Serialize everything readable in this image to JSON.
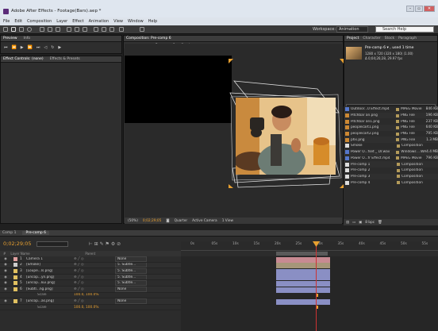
{
  "window": {
    "title": "Adobe After Effects - Footage(Bars).aep *",
    "buttons": [
      "–",
      "▫",
      "✕"
    ]
  },
  "menu": [
    "File",
    "Edit",
    "Composition",
    "Layer",
    "Effect",
    "Animation",
    "View",
    "Window",
    "Help"
  ],
  "toolbar": {
    "workspace_label": "Workspace:",
    "workspace_value": "Animation",
    "search_placeholder": "Search Help"
  },
  "left_panel": {
    "tabs": [
      "Preview",
      "Info"
    ],
    "effect_tabs": [
      "Effect Controls: (none)",
      "Effects & Presets"
    ]
  },
  "composition": {
    "tab": "Composition: Pre-comp 6",
    "sub_tabs": [
      "Pre-comp 6",
      "Smoke"
    ],
    "footer": {
      "zoom": "(50%)",
      "timecode": "0;02;29;05",
      "quality": "Quarter",
      "camera": "Active Camera",
      "views": "1 View"
    }
  },
  "project": {
    "tabs": [
      "Project",
      "Character",
      "Stock",
      "Paragraph"
    ],
    "selected_name": "Pre-comp 6 ▾ , used 1 time",
    "selected_info": [
      "1280 x 720 (320 x 180) (1.00)",
      "Δ 0;04;26;28, 29.97 fps"
    ],
    "columns": [
      "Name",
      "Type",
      "Size"
    ],
    "items": [
      {
        "name": "Outdoor...0 Effect.mp4",
        "type": "MPEG Movie",
        "size": "846 KB",
        "color": "#5577cc"
      },
      {
        "name": "Pitchbar an.png",
        "type": "PNG File",
        "size": "196 KB",
        "color": "#cc8833"
      },
      {
        "name": "Pitchbar an1.png",
        "type": "PNG File",
        "size": "237 KB",
        "color": "#cc8833"
      },
      {
        "name": "peoplecart1.png",
        "type": "PNG File",
        "size": "640 KB",
        "color": "#cc8833"
      },
      {
        "name": "peoplecart2.png",
        "type": "PNG File",
        "size": "795 KB",
        "color": "#cc8833"
      },
      {
        "name": "phx.png",
        "type": "PNG File",
        "size": "1.3 MB",
        "color": "#cc8833"
      },
      {
        "name": "Smoke",
        "type": "Composition",
        "size": "",
        "color": "#dddddd"
      },
      {
        "name": "Power O...fset _ Dr.wav",
        "type": "Windows ...WAV",
        "size": "4.4 MB",
        "color": "#5577cc"
      },
      {
        "name": "Power O...fr Effect.mp4",
        "type": "MPEG Movie",
        "size": "796 KB",
        "color": "#5577cc"
      },
      {
        "name": "Pre-comp 1",
        "type": "Composition",
        "size": "",
        "color": "#dddddd"
      },
      {
        "name": "Pre-comp 2",
        "type": "Composition",
        "size": "",
        "color": "#dddddd"
      },
      {
        "name": "Pre-comp 3",
        "type": "Composition",
        "size": "",
        "color": "#dddddd"
      },
      {
        "name": "Pre-comp 4",
        "type": "Composition",
        "size": "",
        "color": "#dddddd"
      }
    ],
    "footer_bpc": "8 bpc"
  },
  "timeline": {
    "tabs": [
      "Comp 1",
      "Pre-comp 6"
    ],
    "timecode": "0;02;29;05",
    "columns": [
      "#",
      "Layer Name",
      "Parent"
    ],
    "ruler": [
      "0s",
      "05s",
      "10s",
      "15s",
      "20s",
      "25s",
      "30s",
      "35s",
      "40s",
      "45s",
      "50s",
      "55s"
    ],
    "layers": [
      {
        "num": "1",
        "name": "Camera 1",
        "parent": "None",
        "color": "#e0a0a0",
        "bar": "pink"
      },
      {
        "num": "2",
        "name": "[Smoke]",
        "parent": "5. Subtle...",
        "color": "#cccccc",
        "bar": "tan"
      },
      {
        "num": "3",
        "name": "[Loupe...ls.png]",
        "parent": "5. Subtle...",
        "color": "#e0c060",
        "bar": "blue"
      },
      {
        "num": "4",
        "name": "[uncop...yn.png]",
        "parent": "5. Subtle...",
        "color": "#e0c060",
        "bar": "blue"
      },
      {
        "num": "5",
        "name": "[uncop...kui.png]",
        "parent": "5. Subtle...",
        "color": "#e0c060",
        "bar": "blue"
      },
      {
        "num": "6",
        "name": "[Subtl...ng.png]",
        "parent": "None",
        "color": "#e0c060",
        "bar": "blue"
      },
      {
        "num": "",
        "name": "Scale",
        "parent": "",
        "color": "",
        "bar": "none"
      },
      {
        "num": "7",
        "name": "[uncop...as.png]",
        "parent": "None",
        "color": "#e0c060",
        "bar": "blue"
      },
      {
        "num": "",
        "name": "Scale",
        "parent": "",
        "color": "",
        "bar": "none"
      }
    ],
    "scale_value": "100.0, 100.0%"
  },
  "colors": {
    "accent": "#e8a030",
    "playhead": "#cc3333",
    "selection": "#6a6aa8"
  }
}
